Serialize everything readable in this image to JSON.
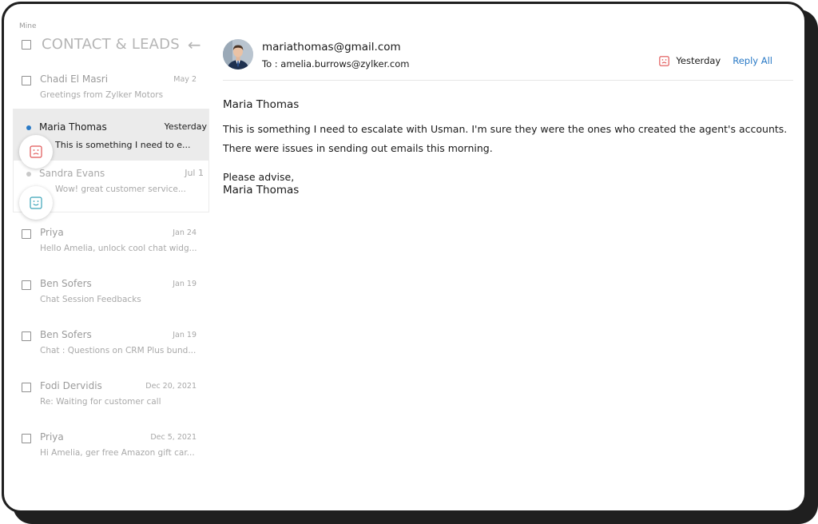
{
  "sidebar": {
    "section_label": "Mine",
    "title": "CONTACT & LEADS",
    "items": [
      {
        "name": "Chadi El Masri",
        "date": "May 2",
        "preview": "Greetings from Zylker Motors"
      },
      {
        "name": "Maria Thomas",
        "date": "Yesterday",
        "preview": "This is something I need to e..."
      },
      {
        "name": "Sandra Evans",
        "date": "Jul 1",
        "preview": "Wow! great customer service..."
      },
      {
        "name": "Priya",
        "date": "Jan 24",
        "preview": "Hello Amelia, unlock cool chat widg..."
      },
      {
        "name": "Ben Sofers",
        "date": "Jan 19",
        "preview": "Chat Session Feedbacks"
      },
      {
        "name": "Ben Sofers",
        "date": "Jan 19",
        "preview": "Chat : Questions on CRM Plus bund..."
      },
      {
        "name": "Fodi Dervidis",
        "date": "Dec 20, 2021",
        "preview": "Re: Waiting for customer call"
      },
      {
        "name": "Priya",
        "date": "Dec 5, 2021",
        "preview": "Hi Amelia, ger free Amazon gift car..."
      }
    ]
  },
  "email": {
    "from": "mariathomas@gmail.com",
    "to": "To : amelia.burrows@zylker.com",
    "when": "Yesterday",
    "reply_all": "Reply All",
    "greeting": "Maria Thomas",
    "line1": "This is something I need to escalate with Usman. I'm sure they were the ones who created the agent's accounts.",
    "line2": "There were issues in sending out emails this morning.",
    "closing": "Please advise,",
    "signature": "Maria Thomas"
  },
  "colors": {
    "accent": "#2a7ac6",
    "sad": "#e05353",
    "happy": "#3aa3b8",
    "selected_bg": "#ebebeb"
  },
  "icons": {
    "sad": "sad-face-icon",
    "happy": "happy-face-icon",
    "back": "arrow-left-icon"
  }
}
